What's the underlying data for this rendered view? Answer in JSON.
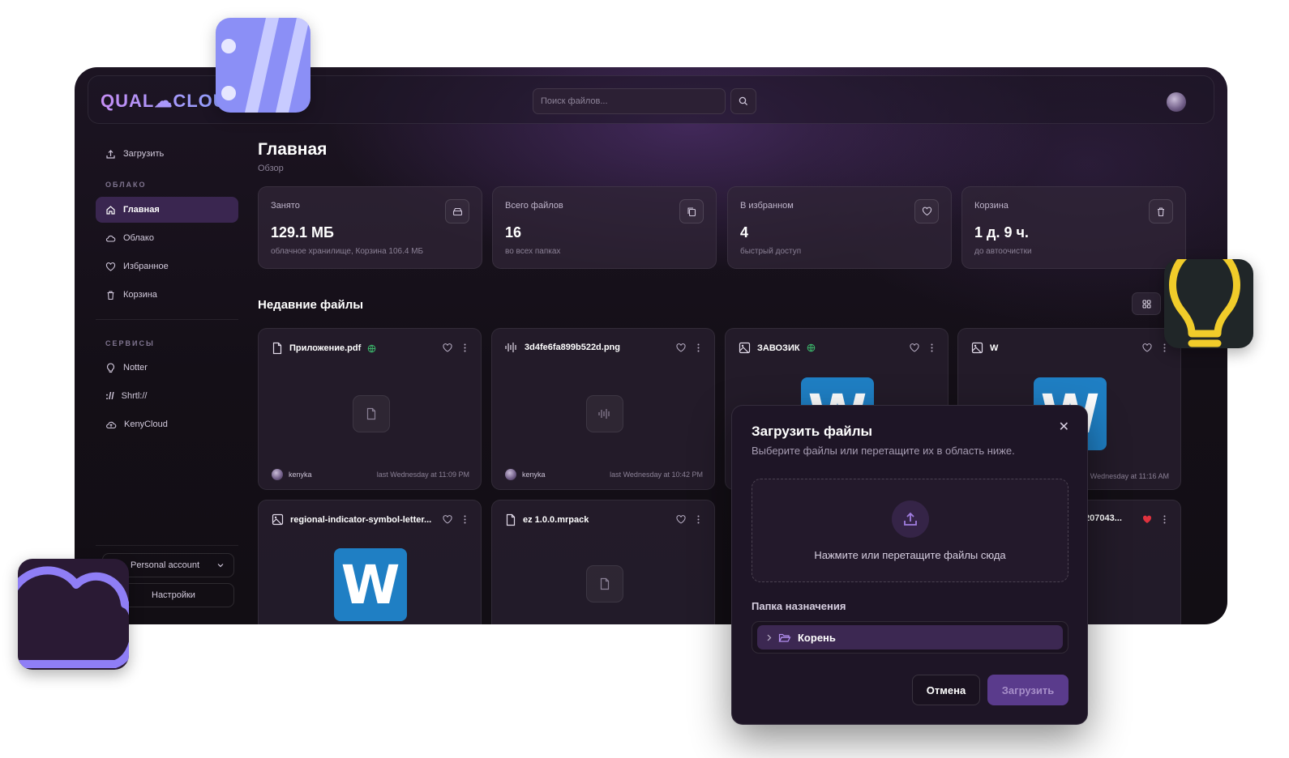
{
  "app": {
    "logo": "QUAL☁CLOU",
    "search_placeholder": "Поиск файлов...",
    "colors": {
      "accent": "#3a2650",
      "brand_gradient_start": "#c58df5",
      "brand_gradient_end": "#8fa2ff"
    }
  },
  "sidebar": {
    "upload_label": "Загрузить",
    "section_cloud": "ОБЛАКО",
    "items": [
      {
        "label": "Главная",
        "icon": "home-icon",
        "active": true
      },
      {
        "label": "Облако",
        "icon": "cloud-icon"
      },
      {
        "label": "Избранное",
        "icon": "heart-icon"
      },
      {
        "label": "Корзина",
        "icon": "trash-icon"
      }
    ],
    "section_services": "СЕРВИСЫ",
    "services": [
      {
        "label": "Notter",
        "icon": "lightbulb-icon"
      },
      {
        "label": "Shrtl://",
        "icon": "link-slashes-icon"
      },
      {
        "label": "KenyCloud",
        "icon": "cloud-upload-icon"
      }
    ],
    "account_select": "Personal account",
    "settings_label": "Настройки"
  },
  "main": {
    "title": "Главная",
    "subtitle": "Обзор",
    "stats": [
      {
        "label": "Занято",
        "value": "129.1 МБ",
        "desc": "облачное хранилище, Корзина 106.4 МБ",
        "icon": "drive-icon"
      },
      {
        "label": "Всего файлов",
        "value": "16",
        "desc": "во всех папках",
        "icon": "copy-icon"
      },
      {
        "label": "В избранном",
        "value": "4",
        "desc": "быстрый доступ",
        "icon": "heart-icon"
      },
      {
        "label": "Корзина",
        "value": "1 д. 9 ч.",
        "desc": "до автоочистки",
        "icon": "trash-icon"
      }
    ],
    "recent_title": "Недавние файлы",
    "files": [
      {
        "name": "Приложение.pdf",
        "icon": "file-icon",
        "shared": true,
        "user": "kenyka",
        "time": "last Wednesday at 11:09 PM"
      },
      {
        "name": "3d4fe6fa899b522d.png",
        "icon": "audio-icon",
        "shared": false,
        "user": "kenyka",
        "time": "last Wednesday at 10:42 PM"
      },
      {
        "name": "ЗАВОЗИК",
        "icon": "image-icon",
        "shared": true,
        "user": "",
        "time": ""
      },
      {
        "name": "W",
        "icon": "image-icon",
        "shared": false,
        "user": "",
        "time": "Wednesday at 11:16 AM"
      },
      {
        "name": "regional-indicator-symbol-letter...",
        "icon": "image-icon",
        "shared": false,
        "user": "",
        "time": ""
      },
      {
        "name": "ez 1.0.0.mrpack",
        "icon": "file-icon",
        "shared": false,
        "user": "",
        "time": ""
      },
      {
        "name": "207043...",
        "icon": "image-icon",
        "shared": false,
        "favorite": true,
        "user": "",
        "time": ""
      }
    ],
    "w_letter": "W"
  },
  "dialog": {
    "title": "Загрузить файлы",
    "description": "Выберите файлы или перетащите их в область ниже.",
    "dropzone_text": "Нажмите или перетащите файлы сюда",
    "folder_label": "Папка назначения",
    "folder_value": "Корень",
    "cancel_label": "Отмена",
    "submit_label": "Загрузить",
    "close_symbol": "✕"
  }
}
